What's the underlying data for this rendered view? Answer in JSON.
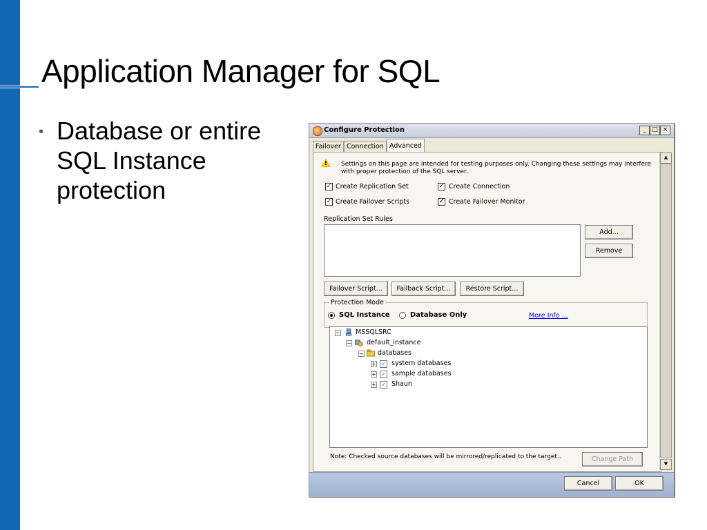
{
  "slide": {
    "title": "Application Manager for SQL",
    "bullet_symbol": "•",
    "bullet_text": "Database or entire SQL Instance protection"
  },
  "dialog": {
    "title": "Configure Protection",
    "window_buttons": {
      "minimize": "_",
      "maximize": "□",
      "close": "×"
    },
    "tabs": [
      {
        "label": "Failover",
        "active": false
      },
      {
        "label": "Connection",
        "active": false
      },
      {
        "label": "Advanced",
        "active": true
      }
    ],
    "warning_text": "Settings on this page are intended for testing purposes only.  Changing these settings may interfere with proper protection of the SQL server.",
    "checkboxes": [
      {
        "label": "Create Replication Set",
        "checked": true
      },
      {
        "label": "Create Connection",
        "checked": true
      },
      {
        "label": "Create Failover Scripts",
        "checked": true
      },
      {
        "label": "Create Failover Monitor",
        "checked": true
      }
    ],
    "replication_rules_label": "Replication Set Rules",
    "add_button": "Add...",
    "remove_button": "Remove",
    "script_buttons": [
      "Failover Script...",
      "Failback Script...",
      "Restore Script..."
    ],
    "protection_mode": {
      "legend": "Protection Mode",
      "options": [
        {
          "label": "SQL Instance",
          "selected": true
        },
        {
          "label": "Database Only",
          "selected": false
        }
      ],
      "more_info": "More Info ..."
    },
    "tree": [
      {
        "label": "MSSQLSRC",
        "expander": "−",
        "icon": "server-icon",
        "checkbox": false
      },
      {
        "label": "default_instance",
        "expander": "−",
        "icon": "instance-icon",
        "checkbox": false
      },
      {
        "label": "databases",
        "expander": "−",
        "icon": "folder-icon",
        "checkbox": false
      },
      {
        "label": "system databases",
        "expander": "+",
        "icon": "",
        "checkbox": true
      },
      {
        "label": "sample databases",
        "expander": "+",
        "icon": "",
        "checkbox": true
      },
      {
        "label": "Shaun",
        "expander": "+",
        "icon": "",
        "checkbox": true
      }
    ],
    "note": "Note: Checked source databases will be mirrored/replicated to the target..",
    "change_path_button": "Change Path",
    "cancel_button": "Cancel",
    "ok_button": "OK",
    "check_glyph": "✓"
  }
}
